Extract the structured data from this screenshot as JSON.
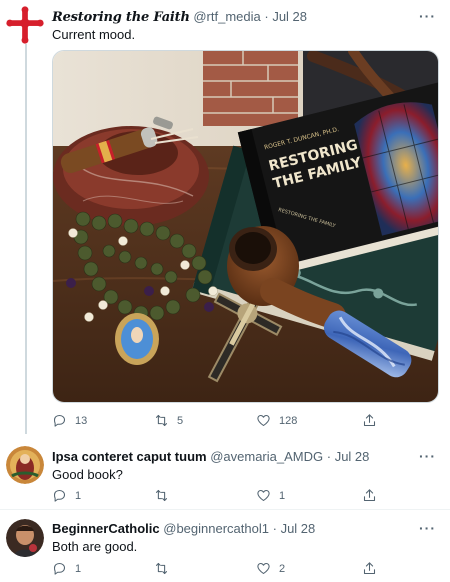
{
  "tweet_main": {
    "display_name": "Restoring the Faith",
    "handle": "@rtf_media",
    "date": "Jul 28",
    "text": "Current mood.",
    "more": "···",
    "book_author": "ROGER T. DUNCAN, PH.D.",
    "book_title_line1": "RESTORING",
    "book_title_line2": "THE FAMILY",
    "spine_text": "RESTORING THE FAMILY",
    "actions": {
      "replies": "13",
      "retweets": "5",
      "likes": "128"
    }
  },
  "reply_1": {
    "display_name": "Ipsa conteret caput tuum",
    "handle": "@avemaria_AMDG",
    "date": "Jul 28",
    "text": "Good book?",
    "more": "···",
    "actions": {
      "replies": "1",
      "retweets": "",
      "likes": "1"
    }
  },
  "reply_2": {
    "display_name": "BeginnerCatholic",
    "handle": "@beginnercathol1",
    "date": "Jul 28",
    "text": "Both are good.",
    "more": "···",
    "actions": {
      "replies": "1",
      "retweets": "",
      "likes": "2"
    }
  },
  "colors": {
    "brand_red": "#d61f2c",
    "secondary_text": "#536471",
    "divider": "#cfd9de"
  },
  "icons": [
    "cross-logo-icon",
    "reply-icon",
    "retweet-icon",
    "like-icon",
    "share-icon",
    "more-icon"
  ]
}
